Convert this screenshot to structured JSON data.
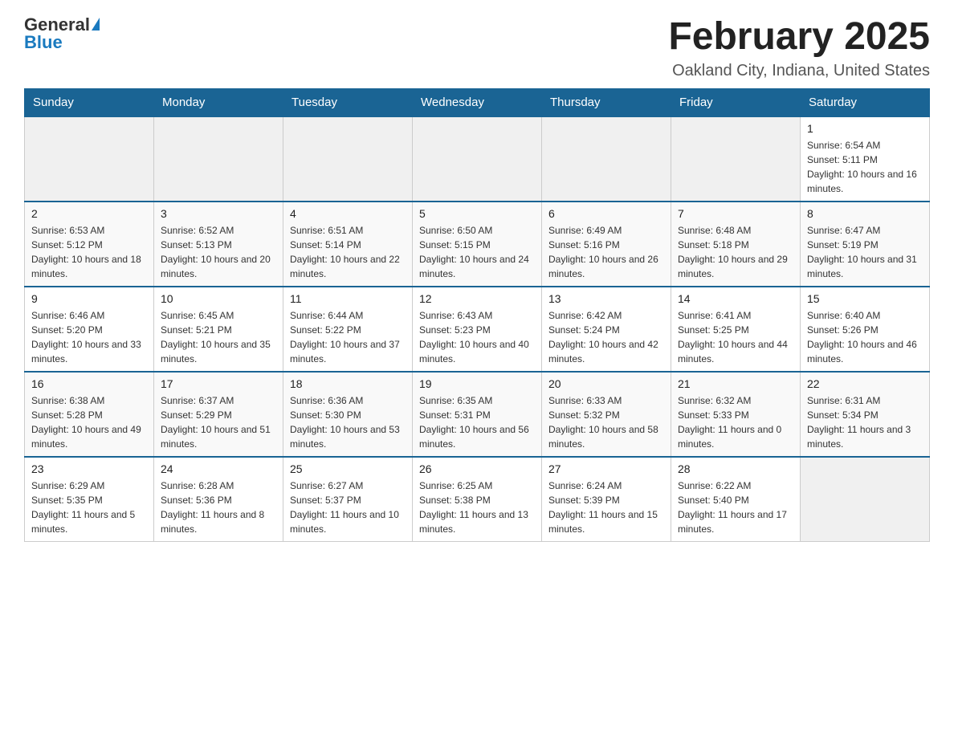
{
  "logo": {
    "general": "General",
    "blue": "Blue"
  },
  "title": "February 2025",
  "location": "Oakland City, Indiana, United States",
  "days_of_week": [
    "Sunday",
    "Monday",
    "Tuesday",
    "Wednesday",
    "Thursday",
    "Friday",
    "Saturday"
  ],
  "weeks": [
    [
      {
        "day": "",
        "info": ""
      },
      {
        "day": "",
        "info": ""
      },
      {
        "day": "",
        "info": ""
      },
      {
        "day": "",
        "info": ""
      },
      {
        "day": "",
        "info": ""
      },
      {
        "day": "",
        "info": ""
      },
      {
        "day": "1",
        "info": "Sunrise: 6:54 AM\nSunset: 5:11 PM\nDaylight: 10 hours and 16 minutes."
      }
    ],
    [
      {
        "day": "2",
        "info": "Sunrise: 6:53 AM\nSunset: 5:12 PM\nDaylight: 10 hours and 18 minutes."
      },
      {
        "day": "3",
        "info": "Sunrise: 6:52 AM\nSunset: 5:13 PM\nDaylight: 10 hours and 20 minutes."
      },
      {
        "day": "4",
        "info": "Sunrise: 6:51 AM\nSunset: 5:14 PM\nDaylight: 10 hours and 22 minutes."
      },
      {
        "day": "5",
        "info": "Sunrise: 6:50 AM\nSunset: 5:15 PM\nDaylight: 10 hours and 24 minutes."
      },
      {
        "day": "6",
        "info": "Sunrise: 6:49 AM\nSunset: 5:16 PM\nDaylight: 10 hours and 26 minutes."
      },
      {
        "day": "7",
        "info": "Sunrise: 6:48 AM\nSunset: 5:18 PM\nDaylight: 10 hours and 29 minutes."
      },
      {
        "day": "8",
        "info": "Sunrise: 6:47 AM\nSunset: 5:19 PM\nDaylight: 10 hours and 31 minutes."
      }
    ],
    [
      {
        "day": "9",
        "info": "Sunrise: 6:46 AM\nSunset: 5:20 PM\nDaylight: 10 hours and 33 minutes."
      },
      {
        "day": "10",
        "info": "Sunrise: 6:45 AM\nSunset: 5:21 PM\nDaylight: 10 hours and 35 minutes."
      },
      {
        "day": "11",
        "info": "Sunrise: 6:44 AM\nSunset: 5:22 PM\nDaylight: 10 hours and 37 minutes."
      },
      {
        "day": "12",
        "info": "Sunrise: 6:43 AM\nSunset: 5:23 PM\nDaylight: 10 hours and 40 minutes."
      },
      {
        "day": "13",
        "info": "Sunrise: 6:42 AM\nSunset: 5:24 PM\nDaylight: 10 hours and 42 minutes."
      },
      {
        "day": "14",
        "info": "Sunrise: 6:41 AM\nSunset: 5:25 PM\nDaylight: 10 hours and 44 minutes."
      },
      {
        "day": "15",
        "info": "Sunrise: 6:40 AM\nSunset: 5:26 PM\nDaylight: 10 hours and 46 minutes."
      }
    ],
    [
      {
        "day": "16",
        "info": "Sunrise: 6:38 AM\nSunset: 5:28 PM\nDaylight: 10 hours and 49 minutes."
      },
      {
        "day": "17",
        "info": "Sunrise: 6:37 AM\nSunset: 5:29 PM\nDaylight: 10 hours and 51 minutes."
      },
      {
        "day": "18",
        "info": "Sunrise: 6:36 AM\nSunset: 5:30 PM\nDaylight: 10 hours and 53 minutes."
      },
      {
        "day": "19",
        "info": "Sunrise: 6:35 AM\nSunset: 5:31 PM\nDaylight: 10 hours and 56 minutes."
      },
      {
        "day": "20",
        "info": "Sunrise: 6:33 AM\nSunset: 5:32 PM\nDaylight: 10 hours and 58 minutes."
      },
      {
        "day": "21",
        "info": "Sunrise: 6:32 AM\nSunset: 5:33 PM\nDaylight: 11 hours and 0 minutes."
      },
      {
        "day": "22",
        "info": "Sunrise: 6:31 AM\nSunset: 5:34 PM\nDaylight: 11 hours and 3 minutes."
      }
    ],
    [
      {
        "day": "23",
        "info": "Sunrise: 6:29 AM\nSunset: 5:35 PM\nDaylight: 11 hours and 5 minutes."
      },
      {
        "day": "24",
        "info": "Sunrise: 6:28 AM\nSunset: 5:36 PM\nDaylight: 11 hours and 8 minutes."
      },
      {
        "day": "25",
        "info": "Sunrise: 6:27 AM\nSunset: 5:37 PM\nDaylight: 11 hours and 10 minutes."
      },
      {
        "day": "26",
        "info": "Sunrise: 6:25 AM\nSunset: 5:38 PM\nDaylight: 11 hours and 13 minutes."
      },
      {
        "day": "27",
        "info": "Sunrise: 6:24 AM\nSunset: 5:39 PM\nDaylight: 11 hours and 15 minutes."
      },
      {
        "day": "28",
        "info": "Sunrise: 6:22 AM\nSunset: 5:40 PM\nDaylight: 11 hours and 17 minutes."
      },
      {
        "day": "",
        "info": ""
      }
    ]
  ]
}
